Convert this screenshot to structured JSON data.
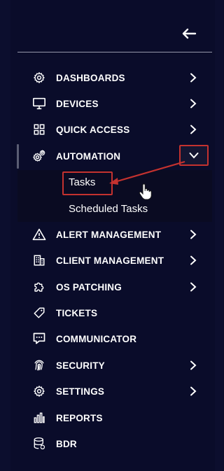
{
  "header": {
    "back_icon": "arrow-left-icon"
  },
  "nav": {
    "items": [
      {
        "label": "DASHBOARDS",
        "icon": "gear-icon",
        "has_chevron": true
      },
      {
        "label": "DEVICES",
        "icon": "monitor-icon",
        "has_chevron": true
      },
      {
        "label": "QUICK ACCESS",
        "icon": "grid-icon",
        "has_chevron": true
      },
      {
        "label": "AUTOMATION",
        "icon": "gears-icon",
        "has_chevron": true,
        "expanded": true
      },
      {
        "label": "ALERT MANAGEMENT",
        "icon": "warning-icon",
        "has_chevron": true
      },
      {
        "label": "CLIENT MANAGEMENT",
        "icon": "building-icon",
        "has_chevron": true
      },
      {
        "label": "OS PATCHING",
        "icon": "puzzle-icon",
        "has_chevron": true
      },
      {
        "label": "TICKETS",
        "icon": "tag-icon",
        "has_chevron": false
      },
      {
        "label": "COMMUNICATOR",
        "icon": "chat-icon",
        "has_chevron": false
      },
      {
        "label": "SECURITY",
        "icon": "fingerprint-icon",
        "has_chevron": true
      },
      {
        "label": "SETTINGS",
        "icon": "gear-icon",
        "has_chevron": true
      },
      {
        "label": "REPORTS",
        "icon": "bar-chart-icon",
        "has_chevron": false
      },
      {
        "label": "BDR",
        "icon": "database-icon",
        "has_chevron": false
      }
    ],
    "automation_sub": [
      {
        "label": "Tasks",
        "highlighted": true
      },
      {
        "label": "Scheduled Tasks"
      }
    ]
  },
  "colors": {
    "background": "#0b0d28",
    "highlight": "#c4322f",
    "text": "#ffffff"
  }
}
